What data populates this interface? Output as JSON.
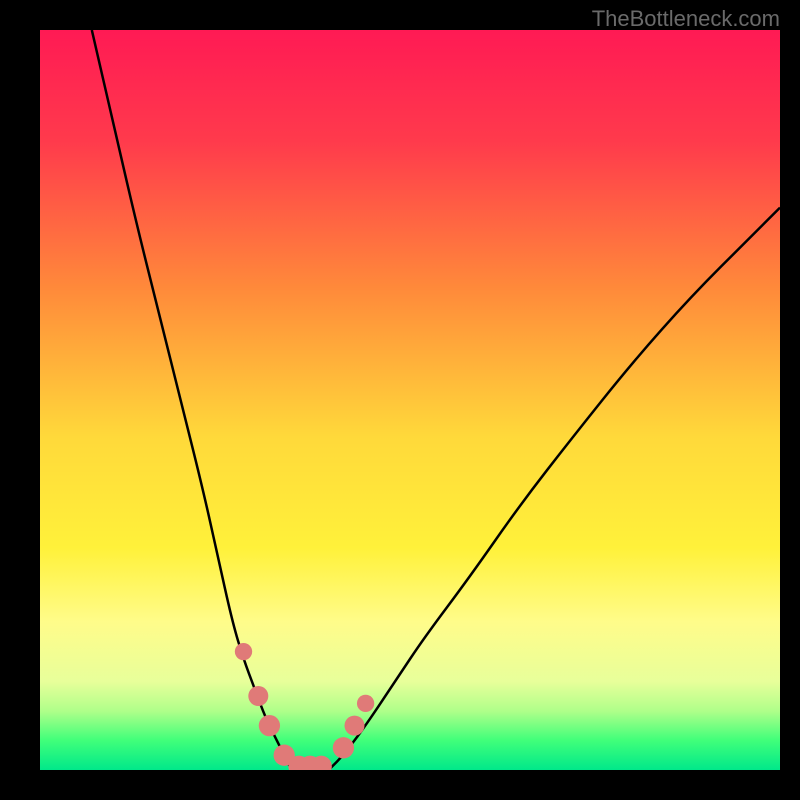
{
  "watermark": "TheBottleneck.com",
  "chart_data": {
    "type": "line",
    "title": "",
    "xlabel": "",
    "ylabel": "",
    "xlim": [
      0,
      100
    ],
    "ylim": [
      0,
      100
    ],
    "series": [
      {
        "name": "left-curve",
        "x": [
          7,
          10,
          13,
          16,
          19,
          22,
          24,
          26,
          27.5,
          29,
          30.5,
          32,
          33,
          34
        ],
        "y": [
          100,
          87,
          74,
          62,
          50,
          38,
          29,
          20,
          15,
          11,
          7,
          4,
          2,
          0
        ]
      },
      {
        "name": "right-curve",
        "x": [
          39,
          41,
          44,
          48,
          52,
          58,
          65,
          72,
          80,
          88,
          96,
          100
        ],
        "y": [
          0,
          2,
          6,
          12,
          18,
          26,
          36,
          45,
          55,
          64,
          72,
          76
        ]
      }
    ],
    "markers": [
      {
        "name": "left-marker-1",
        "x": 27.5,
        "y": 16,
        "r": 1.3
      },
      {
        "name": "left-marker-2",
        "x": 29.5,
        "y": 10,
        "r": 1.5
      },
      {
        "name": "left-marker-3",
        "x": 31,
        "y": 6,
        "r": 1.6
      },
      {
        "name": "left-marker-4",
        "x": 33,
        "y": 2,
        "r": 1.6
      },
      {
        "name": "center-marker-1",
        "x": 35,
        "y": 0.5,
        "r": 1.6
      },
      {
        "name": "center-marker-2",
        "x": 36.5,
        "y": 0.5,
        "r": 1.6
      },
      {
        "name": "center-marker-3",
        "x": 38,
        "y": 0.5,
        "r": 1.6
      },
      {
        "name": "right-marker-1",
        "x": 41,
        "y": 3,
        "r": 1.6
      },
      {
        "name": "right-marker-2",
        "x": 42.5,
        "y": 6,
        "r": 1.5
      },
      {
        "name": "right-marker-3",
        "x": 44,
        "y": 9,
        "r": 1.3
      }
    ],
    "background_gradient": {
      "stops": [
        {
          "offset": 0,
          "color": "#ff1a54"
        },
        {
          "offset": 0.15,
          "color": "#ff3a4c"
        },
        {
          "offset": 0.35,
          "color": "#ff8a3a"
        },
        {
          "offset": 0.55,
          "color": "#ffd93a"
        },
        {
          "offset": 0.7,
          "color": "#fff13a"
        },
        {
          "offset": 0.8,
          "color": "#fffc8a"
        },
        {
          "offset": 0.88,
          "color": "#e8ff9a"
        },
        {
          "offset": 0.92,
          "color": "#b0ff8a"
        },
        {
          "offset": 0.96,
          "color": "#40ff7a"
        },
        {
          "offset": 1.0,
          "color": "#00e88a"
        }
      ]
    },
    "marker_color": "#e07a78",
    "curve_color": "#000000"
  }
}
